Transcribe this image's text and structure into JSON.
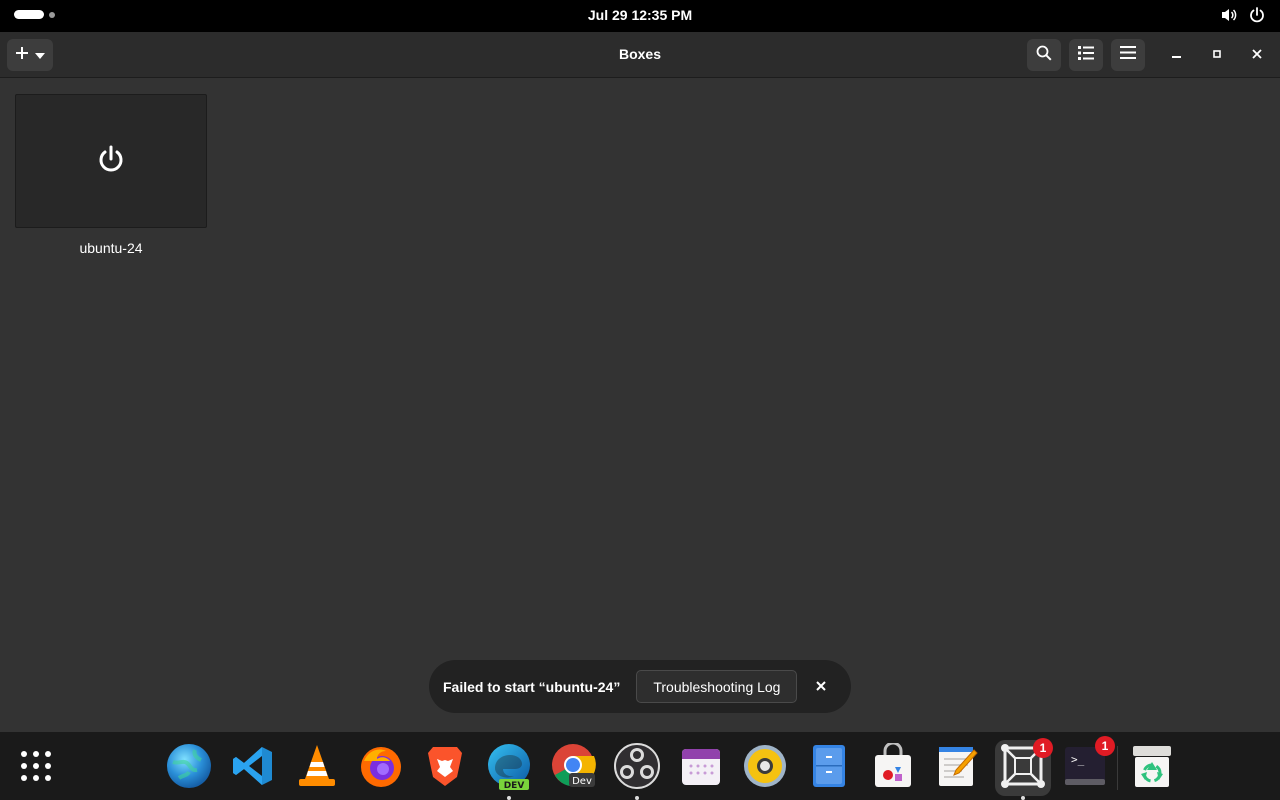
{
  "topbar": {
    "clock": "Jul 29  12:35 PM",
    "icons": [
      "volume-icon",
      "power-icon"
    ]
  },
  "window": {
    "title": "Boxes",
    "header_icons": [
      "add-icon",
      "chevron-down-icon",
      "search-icon",
      "list-view-icon",
      "hamburger-menu-icon",
      "minimize-icon",
      "maximize-icon",
      "close-icon"
    ]
  },
  "boxes": [
    {
      "name": "ubuntu-24",
      "state_icon": "power-icon"
    }
  ],
  "toast": {
    "message": "Failed to start “ubuntu-24”",
    "button_label": "Troubleshooting Log",
    "close_icon": "close-icon"
  },
  "dock": {
    "items": [
      {
        "name": "app-grid",
        "icon": "app-grid-icon"
      },
      {
        "name": "web-browser",
        "icon": "globe-icon"
      },
      {
        "name": "vscode",
        "icon": "vscode-icon"
      },
      {
        "name": "vlc",
        "icon": "vlc-cone-icon"
      },
      {
        "name": "firefox",
        "icon": "firefox-icon"
      },
      {
        "name": "brave",
        "icon": "brave-lion-icon"
      },
      {
        "name": "edge-dev",
        "icon": "edge-icon",
        "label": "DEV",
        "running": true
      },
      {
        "name": "chrome-dev",
        "icon": "chrome-icon",
        "label": "Dev"
      },
      {
        "name": "obs",
        "icon": "obs-icon",
        "running": true
      },
      {
        "name": "calendar",
        "icon": "calendar-icon"
      },
      {
        "name": "rhythmbox",
        "icon": "speaker-icon"
      },
      {
        "name": "file-cabinet",
        "icon": "file-cabinet-icon"
      },
      {
        "name": "software",
        "icon": "shopping-bag-icon"
      },
      {
        "name": "text-editor",
        "icon": "text-editor-icon"
      },
      {
        "name": "boxes",
        "icon": "boxes-icon",
        "badge": "1",
        "running": true,
        "active": true
      },
      {
        "name": "terminal",
        "icon": "terminal-icon",
        "label": ">_",
        "badge": "1"
      },
      {
        "name": "trash",
        "icon": "recycle-bin-icon"
      }
    ]
  },
  "colors": {
    "window_bg": "#333333",
    "headerbar_bg": "#2c2c2c",
    "topbar_bg": "#000000",
    "dock_bg": "#1a1a1a",
    "badge": "#e01b24"
  }
}
